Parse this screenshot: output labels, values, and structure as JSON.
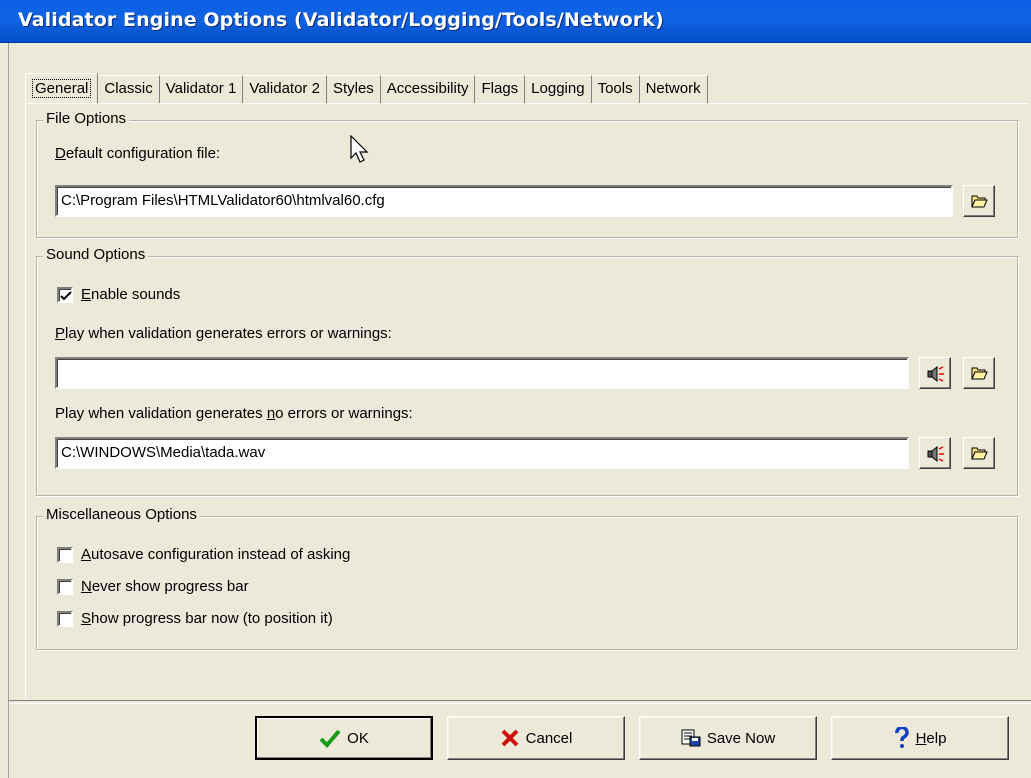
{
  "window": {
    "title": "Validator Engine Options (Validator/Logging/Tools/Network)"
  },
  "tabs": [
    {
      "label": "General",
      "active": true
    },
    {
      "label": "Classic"
    },
    {
      "label": "Validator 1"
    },
    {
      "label": "Validator 2"
    },
    {
      "label": "Styles"
    },
    {
      "label": "Accessibility"
    },
    {
      "label": "Flags"
    },
    {
      "label": "Logging"
    },
    {
      "label": "Tools"
    },
    {
      "label": "Network"
    }
  ],
  "file_options": {
    "legend": "File Options",
    "config_label_key": "D",
    "config_label_rest": "efault configuration file:",
    "config_value": "C:\\Program Files\\HTMLValidator60\\htmlval60.cfg"
  },
  "sound_options": {
    "legend": "Sound Options",
    "enable_key": "E",
    "enable_rest": "nable sounds",
    "enable_checked": true,
    "errors_key": "P",
    "errors_rest": "lay when validation generates errors or warnings:",
    "errors_value": "",
    "noerrors_pre": "Play when validation generates ",
    "noerrors_key": "n",
    "noerrors_post": "o errors or warnings:",
    "noerrors_value": "C:\\WINDOWS\\Media\\tada.wav"
  },
  "misc_options": {
    "legend": "Miscellaneous Options",
    "items": [
      {
        "key": "A",
        "rest": "utosave configuration instead of asking",
        "checked": false
      },
      {
        "key": "N",
        "rest": "ever show progress bar",
        "checked": false
      },
      {
        "key": "S",
        "rest": "how progress bar now (to position it)",
        "checked": false
      }
    ]
  },
  "buttons": {
    "ok": "OK",
    "cancel": "Cancel",
    "save_now": "Save Now",
    "help_key": "H",
    "help_rest": "elp"
  },
  "icons": {
    "browse": "folder-open-icon",
    "play": "speaker-icon",
    "ok": "green-check-icon",
    "cancel": "red-x-icon",
    "save": "save-disk-icon",
    "help": "question-mark-icon"
  }
}
